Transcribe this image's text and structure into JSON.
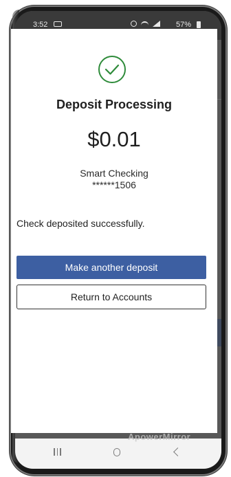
{
  "status_bar": {
    "time": "3:52",
    "battery": "57%"
  },
  "modal": {
    "title": "Deposit Processing",
    "amount": "$0.01",
    "account_name": "Smart Checking",
    "account_number": "******1506",
    "message": "Check deposited successfully.",
    "primary_button": "Make another deposit",
    "secondary_button": "Return to Accounts",
    "icon": "check-circle-icon"
  },
  "watermark": "ApowerMirror",
  "colors": {
    "accent": "#3d5fa2",
    "success": "#2e8b3a"
  },
  "nav": {
    "icons": [
      "recents-icon",
      "home-icon",
      "back-icon"
    ]
  }
}
